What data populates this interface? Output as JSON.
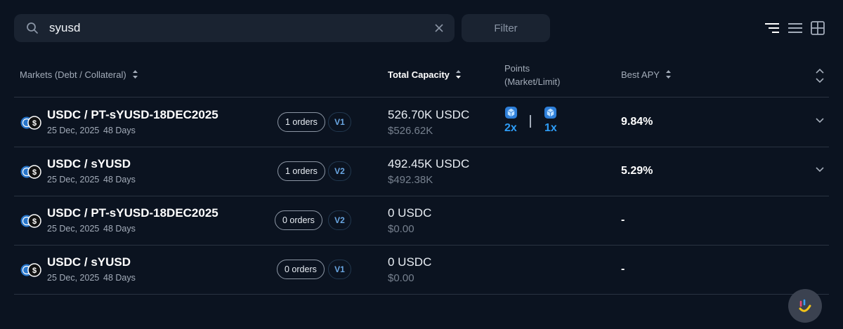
{
  "search": {
    "value": "syusd",
    "placeholder": "Search"
  },
  "filter": {
    "label": "Filter"
  },
  "view_modes": [
    "compact-list-icon",
    "list-icon",
    "grid-icon"
  ],
  "table": {
    "headers": {
      "markets": "Markets (Debt / Collateral)",
      "capacity": "Total Capacity",
      "points_line1": "Points",
      "points_line2": "(Market/Limit)",
      "apy": "Best APY"
    },
    "rows": [
      {
        "name": "USDC / PT-sYUSD-18DEC2025",
        "date": "25 Dec, 2025",
        "days": "48 Days",
        "orders": "1 orders",
        "version": "V1",
        "capacity": "526.70K USDC",
        "capacity_usd": "$526.62K",
        "points_market": "2x",
        "points_limit": "1x",
        "apy": "9.84%",
        "expandable": true
      },
      {
        "name": "USDC / sYUSD",
        "date": "25 Dec, 2025",
        "days": "48 Days",
        "orders": "1 orders",
        "version": "V2",
        "capacity": "492.45K USDC",
        "capacity_usd": "$492.38K",
        "points_market": "",
        "points_limit": "",
        "apy": "5.29%",
        "expandable": true
      },
      {
        "name": "USDC / PT-sYUSD-18DEC2025",
        "date": "25 Dec, 2025",
        "days": "48 Days",
        "orders": "0 orders",
        "version": "V2",
        "capacity": "0 USDC",
        "capacity_usd": "$0.00",
        "points_market": "",
        "points_limit": "",
        "apy": "-",
        "expandable": false
      },
      {
        "name": "USDC / sYUSD",
        "date": "25 Dec, 2025",
        "days": "48 Days",
        "orders": "0 orders",
        "version": "V1",
        "capacity": "0 USDC",
        "capacity_usd": "$0.00",
        "points_market": "",
        "points_limit": "",
        "apy": "-",
        "expandable": false
      }
    ]
  },
  "colors": {
    "background": "#0b1320",
    "accent": "#2e9df7",
    "version_badge": "#6aa7e3"
  }
}
